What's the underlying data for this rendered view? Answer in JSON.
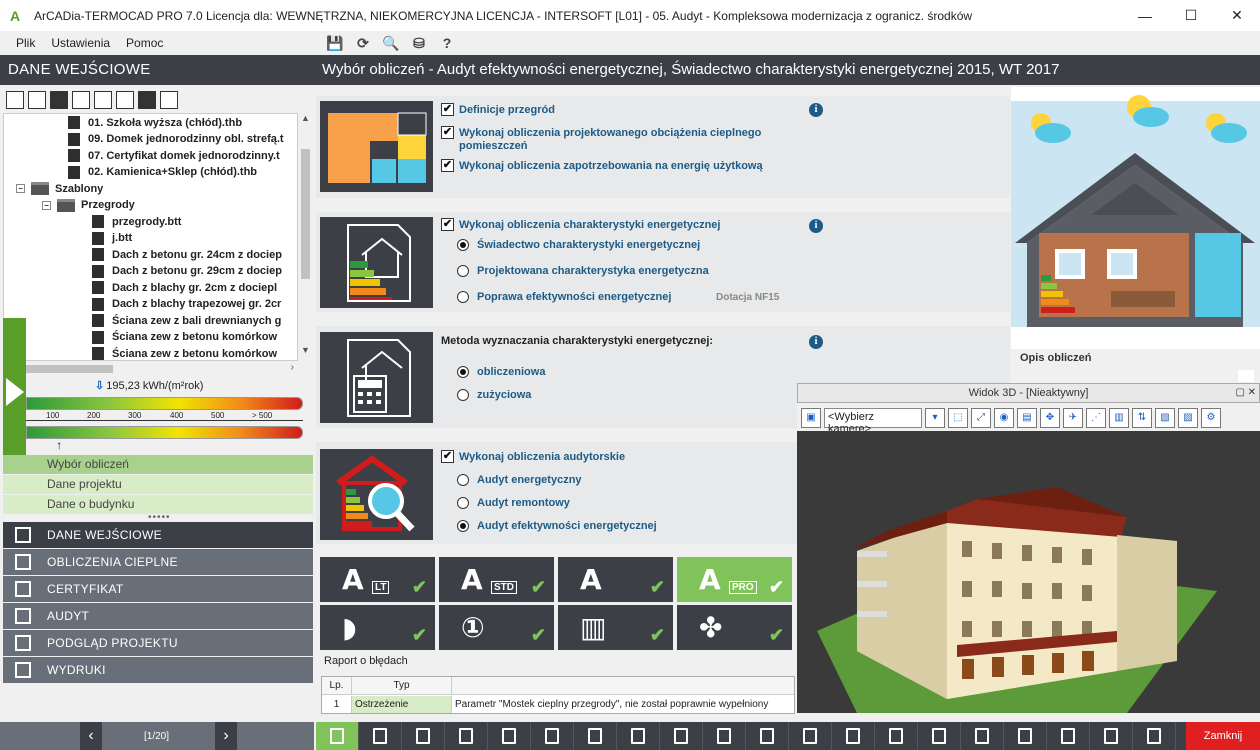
{
  "window": {
    "title": "ArCADia-TERMOCAD PRO 7.0 Licencja dla: WEWNĘTRZNA, NIEKOMERCYJNA LICENCJA - INTERSOFT [L01] - 05. Audyt - Kompleksowa modernizacja z ogranicz. środków",
    "minimize": "—",
    "maximize": "☐",
    "close": "✕"
  },
  "menu": {
    "file": "Plik",
    "settings": "Ustawienia",
    "help": "Pomoc"
  },
  "quick_tools": [
    "💾",
    "⟳",
    "🔍",
    "⛁",
    "?"
  ],
  "left": {
    "header": "DANE WEJŚCIOWE",
    "tree": [
      {
        "label": "01. Szkoła wyższa (chłód).thb",
        "bold": true
      },
      {
        "label": "09. Domek jednorodzinny obl. strefą.t",
        "bold": true
      },
      {
        "label": "07. Certyfikat domek jednorodzinny.t",
        "bold": true
      },
      {
        "label": "02. Kamienica+Sklep (chłód).thb",
        "bold": true
      },
      {
        "label": "Szablony",
        "bold": true,
        "folder": true
      },
      {
        "label": "Przegrody",
        "bold": true,
        "folder": true
      },
      {
        "label": "przegrody.btt",
        "bold": true
      },
      {
        "label": "j.btt",
        "bold": true
      },
      {
        "label": "Dach z betonu gr. 24cm z dociep",
        "bold": true
      },
      {
        "label": "Dach z betonu gr. 29cm z dociep",
        "bold": true
      },
      {
        "label": "Dach z blachy gr. 2cm z dociepl",
        "bold": true
      },
      {
        "label": "Dach z blachy trapezowej gr. 2cr",
        "bold": true
      },
      {
        "label": "Ściana zew z bali drewnianych g",
        "bold": true
      },
      {
        "label": "Ściana zew z betonu komórkow",
        "bold": true
      },
      {
        "label": "Ściana zew z betonu komórkow",
        "bold": true
      }
    ],
    "energy": {
      "value": "195,23 kWh/(m²rok)",
      "value_fraction": 0.39,
      "scale_labels": [
        "100",
        "200",
        "300",
        "400",
        "500",
        "> 500"
      ]
    },
    "subnav": [
      "Wybór obliczeń",
      "Dane projektu",
      "Dane o budynku"
    ],
    "mainnav": [
      "DANE WEJŚCIOWE",
      "OBLICZENIA CIEPLNE",
      "CERTYFIKAT",
      "AUDYT",
      "PODGLĄD PROJEKTU",
      "WYDRUKI"
    ],
    "pager": {
      "prev": "‹",
      "next": "›",
      "count": "[1/20]"
    }
  },
  "main": {
    "header": "Wybór obliczeń - Audyt efektywności energetycznej, Świadectwo charakterystyki energetycznej 2015, WT 2017",
    "section1": {
      "opt1": "Definicje przegród",
      "opt2a": "Wykonaj obliczenia projektowanego obciążenia cieplnego",
      "opt2b": "pomieszczeń",
      "opt3": "Wykonaj obliczenia zapotrzebowania na energię użytkową"
    },
    "section2": {
      "main": "Wykonaj obliczenia charakterystyki energetycznej",
      "r1": "Świadectwo charakterystyki energetycznej",
      "r2": "Projektowana charakterystyka energetyczna",
      "r3": "Poprawa efektywności energetycznej",
      "dotacja": "Dotacja NF15"
    },
    "section3": {
      "title": "Metoda wyznaczania charakterystyki energetycznej:",
      "r1": "obliczeniowa",
      "r2": "zużyciowa"
    },
    "section4": {
      "main": "Wykonaj obliczenia audytorskie",
      "r1": "Audyt energetyczny",
      "r2": "Audyt remontowy",
      "r3": "Audyt efektywności energetycznej"
    },
    "info": "i",
    "check": "✔",
    "modules": [
      {
        "glyph": "A",
        "sub": "LT"
      },
      {
        "glyph": "A",
        "sub": "STD"
      },
      {
        "glyph": "A",
        "sub": ""
      },
      {
        "glyph": "A",
        "sub": "PRO"
      },
      {
        "glyph": "◗",
        "sub": ""
      },
      {
        "glyph": "①",
        "sub": ""
      },
      {
        "glyph": "▥",
        "sub": ""
      },
      {
        "glyph": "✤",
        "sub": ""
      }
    ],
    "report": {
      "title": "Raport o błędach",
      "headers": {
        "lp": "Lp.",
        "typ": "Typ",
        "desc": ""
      },
      "row": {
        "lp": "1",
        "typ": "Ostrzeżenie",
        "desc": "Parametr \"Mostek cieplny przegrody\", nie został poprawnie wypełniony"
      }
    }
  },
  "preview": {
    "caption": "Opis obliczeń"
  },
  "view3d": {
    "title": "Widok 3D - [Nieaktywny]",
    "pin": "▢",
    "close": "✕",
    "camera_select": "<Wybierz kamerę>"
  },
  "bottom": {
    "close": "Zamknij"
  },
  "colors": {
    "dark": "#3c3f45",
    "accent_green": "#7fc35a",
    "link_blue": "#1d5b86",
    "close_red": "#e02020"
  }
}
